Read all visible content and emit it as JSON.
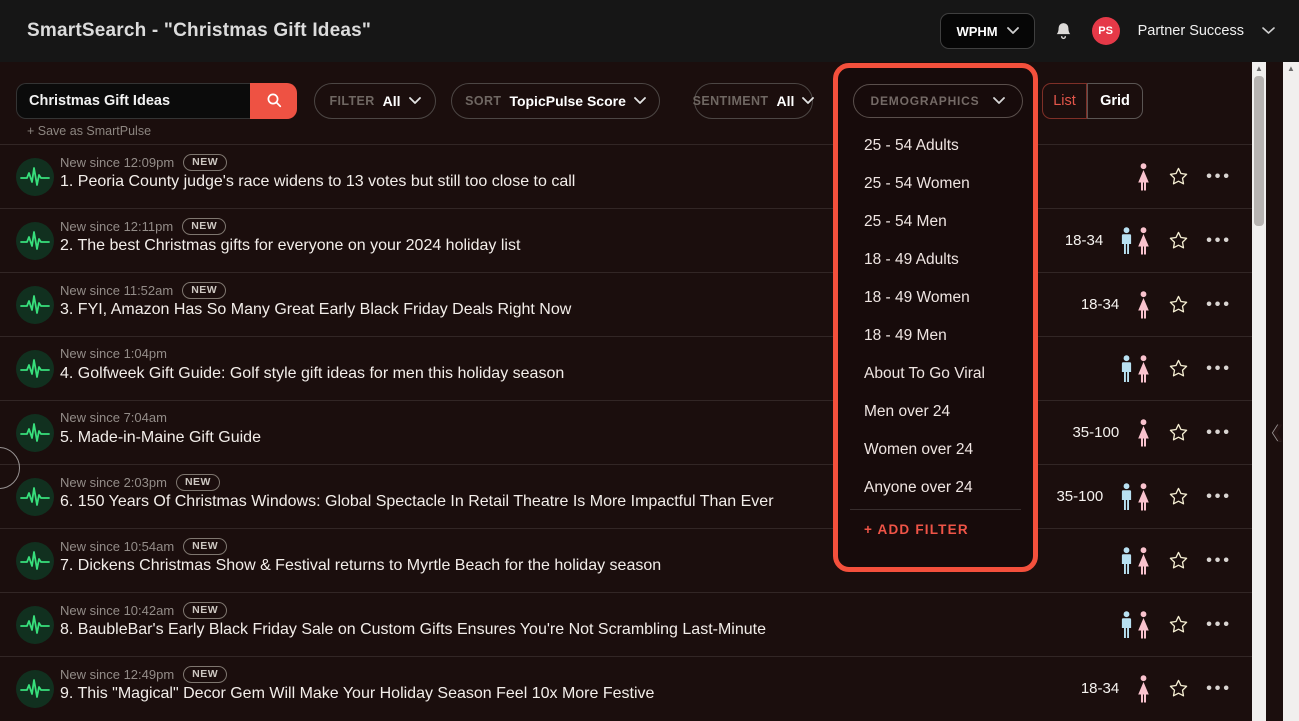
{
  "header": {
    "title": "SmartSearch - \"Christmas Gift Ideas\"",
    "org_button_label": "WPHM",
    "user": {
      "initials": "PS",
      "name": "Partner Success"
    }
  },
  "toolbar": {
    "search_value": "Christmas Gift Ideas",
    "save_link": "+ Save as SmartPulse",
    "filter": {
      "label": "FILTER",
      "value": "All"
    },
    "sort": {
      "label": "SORT",
      "value": "TopicPulse Score"
    },
    "sentiment": {
      "label": "SENTIMENT",
      "value": "All"
    },
    "demographics_label": "DEMOGRAPHICS",
    "view_toggle": {
      "list": "List",
      "grid": "Grid",
      "active": "List"
    }
  },
  "demographics_menu": {
    "items": [
      "25 - 54 Adults",
      "25 - 54 Women",
      "25 - 54 Men",
      "18 - 49 Adults",
      "18 - 49 Women",
      "18 - 49 Men",
      "About To Go Viral",
      "Men over 24",
      "Women over 24",
      "Anyone over 24"
    ],
    "add_filter": "+ ADD FILTER"
  },
  "rows": [
    {
      "meta": "New since 12:09pm",
      "badge": "NEW",
      "title": "1. Peoria County judge's race widens to 13 votes but still too close to call",
      "age": null,
      "genders": [
        "female"
      ]
    },
    {
      "meta": "New since 12:11pm",
      "badge": "NEW",
      "title": "2. The best Christmas gifts for everyone on your 2024 holiday list",
      "age": "18-34",
      "genders": [
        "male",
        "female"
      ]
    },
    {
      "meta": "New since 11:52am",
      "badge": "NEW",
      "title": "3. FYI, Amazon Has So Many Great Early Black Friday Deals Right Now",
      "age": "18-34",
      "genders": [
        "female"
      ]
    },
    {
      "meta": "New since 1:04pm",
      "badge": null,
      "title": "4. Golfweek Gift Guide: Golf style gift ideas for men this holiday season",
      "age": null,
      "genders": [
        "male",
        "female"
      ]
    },
    {
      "meta": "New since 7:04am",
      "badge": null,
      "title": "5. Made-in-Maine Gift Guide",
      "age": "35-100",
      "genders": [
        "female"
      ]
    },
    {
      "meta": "New since 2:03pm",
      "badge": "NEW",
      "title": "6. 150 Years Of Christmas Windows: Global Spectacle In Retail Theatre Is More Impactful Than Ever",
      "age": "35-100",
      "genders": [
        "male",
        "female"
      ]
    },
    {
      "meta": "New since 10:54am",
      "badge": "NEW",
      "title": "7. Dickens Christmas Show & Festival returns to Myrtle Beach for the holiday season",
      "age": null,
      "genders": [
        "male",
        "female"
      ]
    },
    {
      "meta": "New since 10:42am",
      "badge": "NEW",
      "title": "8. BaubleBar's Early Black Friday Sale on Custom Gifts Ensures You're Not Scrambling Last-Minute",
      "age": null,
      "genders": [
        "male",
        "female"
      ]
    },
    {
      "meta": "New since 12:49pm",
      "badge": "NEW",
      "title": "9. This \"Magical\" Decor Gem Will Make Your Holiday Season Feel 10x More Festive",
      "age": "18-34",
      "genders": [
        "female"
      ]
    }
  ],
  "icons": {
    "search": "search-icon",
    "bell": "bell-icon",
    "chevron": "chevron-down-icon",
    "pulse": "pulse-icon",
    "male": "male-icon",
    "female": "female-icon",
    "star": "star-icon",
    "more": "more-options-icon",
    "collapse": "collapse-chevron-icon"
  },
  "colors": {
    "accent_red": "#ee5243",
    "highlight_border": "#f4503c",
    "avatar_red": "#e53948",
    "pulse_green": "#38df7c",
    "male_icon": "#b9e1f2",
    "female_icon": "#f9c2cd",
    "star_outline": "#f6efd3",
    "list_active_text": "#e3564a",
    "header_bg": "#161616",
    "content_bg": "#1b0e0d"
  }
}
